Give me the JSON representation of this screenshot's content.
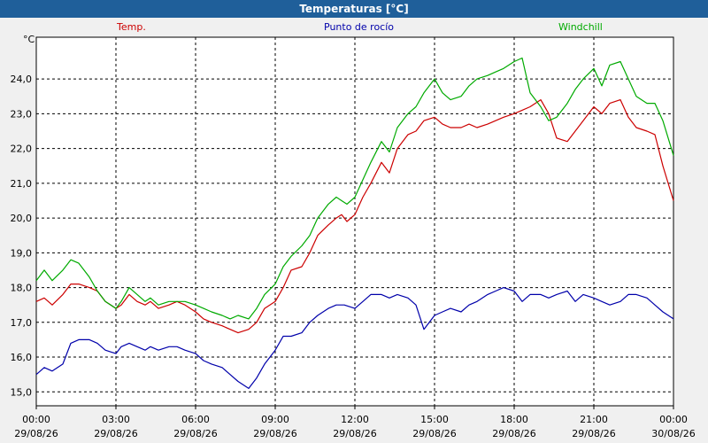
{
  "window": {
    "title": "Temperaturas [°C]"
  },
  "chart_data": {
    "type": "line",
    "title": "Temperaturas [°C]",
    "ylabel": "°C",
    "ylim": [
      14.6,
      25.2
    ],
    "y_ticks": [
      "15,0",
      "16,0",
      "17,0",
      "18,0",
      "19,0",
      "20,0",
      "21,0",
      "22,0",
      "23,0",
      "24,0"
    ],
    "y_tick_values": [
      15,
      16,
      17,
      18,
      19,
      20,
      21,
      22,
      23,
      24
    ],
    "x_ticks": [
      {
        "time": "00:00",
        "date": "29/08/26"
      },
      {
        "time": "03:00",
        "date": "29/08/26"
      },
      {
        "time": "06:00",
        "date": "29/08/26"
      },
      {
        "time": "09:00",
        "date": "29/08/26"
      },
      {
        "time": "12:00",
        "date": "29/08/26"
      },
      {
        "time": "15:00",
        "date": "29/08/26"
      },
      {
        "time": "18:00",
        "date": "29/08/26"
      },
      {
        "time": "21:00",
        "date": "29/08/26"
      },
      {
        "time": "00:00",
        "date": "30/08/26"
      }
    ],
    "x_range_hours": [
      0,
      24
    ],
    "grid": true,
    "series": [
      {
        "name": "Temp.",
        "color": "#cc0000",
        "legend_position": "top-left",
        "points": [
          [
            0,
            17.6
          ],
          [
            0.3,
            17.7
          ],
          [
            0.6,
            17.5
          ],
          [
            1,
            17.8
          ],
          [
            1.3,
            18.1
          ],
          [
            1.6,
            18.1
          ],
          [
            2,
            18.0
          ],
          [
            2.3,
            17.9
          ],
          [
            2.6,
            17.6
          ],
          [
            3,
            17.4
          ],
          [
            3.2,
            17.5
          ],
          [
            3.5,
            17.8
          ],
          [
            3.8,
            17.6
          ],
          [
            4.1,
            17.5
          ],
          [
            4.3,
            17.6
          ],
          [
            4.6,
            17.4
          ],
          [
            5,
            17.5
          ],
          [
            5.3,
            17.6
          ],
          [
            5.6,
            17.5
          ],
          [
            6,
            17.3
          ],
          [
            6.3,
            17.1
          ],
          [
            6.6,
            17.0
          ],
          [
            7,
            16.9
          ],
          [
            7.3,
            16.8
          ],
          [
            7.6,
            16.7
          ],
          [
            8,
            16.8
          ],
          [
            8.3,
            17.0
          ],
          [
            8.6,
            17.4
          ],
          [
            9,
            17.6
          ],
          [
            9.3,
            18.0
          ],
          [
            9.6,
            18.5
          ],
          [
            10,
            18.6
          ],
          [
            10.3,
            19.0
          ],
          [
            10.6,
            19.5
          ],
          [
            11,
            19.8
          ],
          [
            11.3,
            20.0
          ],
          [
            11.5,
            20.1
          ],
          [
            11.7,
            19.9
          ],
          [
            12,
            20.1
          ],
          [
            12.3,
            20.6
          ],
          [
            12.6,
            21.0
          ],
          [
            13,
            21.6
          ],
          [
            13.3,
            21.3
          ],
          [
            13.6,
            22.0
          ],
          [
            14,
            22.4
          ],
          [
            14.3,
            22.5
          ],
          [
            14.6,
            22.8
          ],
          [
            15,
            22.9
          ],
          [
            15.3,
            22.7
          ],
          [
            15.6,
            22.6
          ],
          [
            16,
            22.6
          ],
          [
            16.3,
            22.7
          ],
          [
            16.6,
            22.6
          ],
          [
            17,
            22.7
          ],
          [
            17.3,
            22.8
          ],
          [
            17.6,
            22.9
          ],
          [
            18,
            23.0
          ],
          [
            18.3,
            23.1
          ],
          [
            18.6,
            23.2
          ],
          [
            19,
            23.4
          ],
          [
            19.3,
            23.0
          ],
          [
            19.6,
            22.3
          ],
          [
            20,
            22.2
          ],
          [
            20.3,
            22.5
          ],
          [
            20.6,
            22.8
          ],
          [
            21,
            23.2
          ],
          [
            21.3,
            23.0
          ],
          [
            21.6,
            23.3
          ],
          [
            22,
            23.4
          ],
          [
            22.3,
            22.9
          ],
          [
            22.6,
            22.6
          ],
          [
            23,
            22.5
          ],
          [
            23.3,
            22.4
          ],
          [
            23.6,
            21.5
          ],
          [
            24,
            20.5
          ]
        ]
      },
      {
        "name": "Punto de rocío",
        "color": "#0000aa",
        "legend_position": "top-center",
        "points": [
          [
            0,
            15.5
          ],
          [
            0.3,
            15.7
          ],
          [
            0.6,
            15.6
          ],
          [
            1,
            15.8
          ],
          [
            1.3,
            16.4
          ],
          [
            1.6,
            16.5
          ],
          [
            2,
            16.5
          ],
          [
            2.3,
            16.4
          ],
          [
            2.6,
            16.2
          ],
          [
            3,
            16.1
          ],
          [
            3.2,
            16.3
          ],
          [
            3.5,
            16.4
          ],
          [
            3.8,
            16.3
          ],
          [
            4.1,
            16.2
          ],
          [
            4.3,
            16.3
          ],
          [
            4.6,
            16.2
          ],
          [
            5,
            16.3
          ],
          [
            5.3,
            16.3
          ],
          [
            5.6,
            16.2
          ],
          [
            6,
            16.1
          ],
          [
            6.3,
            15.9
          ],
          [
            6.6,
            15.8
          ],
          [
            7,
            15.7
          ],
          [
            7.3,
            15.5
          ],
          [
            7.6,
            15.3
          ],
          [
            8,
            15.1
          ],
          [
            8.3,
            15.4
          ],
          [
            8.6,
            15.8
          ],
          [
            9,
            16.2
          ],
          [
            9.3,
            16.6
          ],
          [
            9.6,
            16.6
          ],
          [
            10,
            16.7
          ],
          [
            10.3,
            17.0
          ],
          [
            10.6,
            17.2
          ],
          [
            11,
            17.4
          ],
          [
            11.3,
            17.5
          ],
          [
            11.6,
            17.5
          ],
          [
            12,
            17.4
          ],
          [
            12.3,
            17.6
          ],
          [
            12.6,
            17.8
          ],
          [
            13,
            17.8
          ],
          [
            13.3,
            17.7
          ],
          [
            13.6,
            17.8
          ],
          [
            14,
            17.7
          ],
          [
            14.3,
            17.5
          ],
          [
            14.6,
            16.8
          ],
          [
            15,
            17.2
          ],
          [
            15.3,
            17.3
          ],
          [
            15.6,
            17.4
          ],
          [
            16,
            17.3
          ],
          [
            16.3,
            17.5
          ],
          [
            16.6,
            17.6
          ],
          [
            17,
            17.8
          ],
          [
            17.3,
            17.9
          ],
          [
            17.6,
            18.0
          ],
          [
            18,
            17.9
          ],
          [
            18.3,
            17.6
          ],
          [
            18.6,
            17.8
          ],
          [
            19,
            17.8
          ],
          [
            19.3,
            17.7
          ],
          [
            19.6,
            17.8
          ],
          [
            20,
            17.9
          ],
          [
            20.3,
            17.6
          ],
          [
            20.6,
            17.8
          ],
          [
            21,
            17.7
          ],
          [
            21.3,
            17.6
          ],
          [
            21.6,
            17.5
          ],
          [
            22,
            17.6
          ],
          [
            22.3,
            17.8
          ],
          [
            22.6,
            17.8
          ],
          [
            23,
            17.7
          ],
          [
            23.3,
            17.5
          ],
          [
            23.6,
            17.3
          ],
          [
            24,
            17.1
          ]
        ]
      },
      {
        "name": "Windchill",
        "color": "#00aa00",
        "legend_position": "top-right",
        "points": [
          [
            0,
            18.2
          ],
          [
            0.3,
            18.5
          ],
          [
            0.6,
            18.2
          ],
          [
            1,
            18.5
          ],
          [
            1.3,
            18.8
          ],
          [
            1.6,
            18.7
          ],
          [
            2,
            18.3
          ],
          [
            2.3,
            17.9
          ],
          [
            2.6,
            17.6
          ],
          [
            3,
            17.4
          ],
          [
            3.2,
            17.6
          ],
          [
            3.5,
            18.0
          ],
          [
            3.8,
            17.8
          ],
          [
            4.1,
            17.6
          ],
          [
            4.3,
            17.7
          ],
          [
            4.6,
            17.5
          ],
          [
            5,
            17.6
          ],
          [
            5.3,
            17.6
          ],
          [
            5.6,
            17.6
          ],
          [
            6,
            17.5
          ],
          [
            6.3,
            17.4
          ],
          [
            6.6,
            17.3
          ],
          [
            7,
            17.2
          ],
          [
            7.3,
            17.1
          ],
          [
            7.6,
            17.2
          ],
          [
            8,
            17.1
          ],
          [
            8.3,
            17.4
          ],
          [
            8.6,
            17.8
          ],
          [
            9,
            18.1
          ],
          [
            9.3,
            18.6
          ],
          [
            9.6,
            18.9
          ],
          [
            10,
            19.2
          ],
          [
            10.3,
            19.5
          ],
          [
            10.6,
            20.0
          ],
          [
            11,
            20.4
          ],
          [
            11.3,
            20.6
          ],
          [
            11.5,
            20.5
          ],
          [
            11.7,
            20.4
          ],
          [
            12,
            20.6
          ],
          [
            12.3,
            21.1
          ],
          [
            12.6,
            21.6
          ],
          [
            13,
            22.2
          ],
          [
            13.3,
            21.9
          ],
          [
            13.6,
            22.6
          ],
          [
            14,
            23.0
          ],
          [
            14.3,
            23.2
          ],
          [
            14.6,
            23.6
          ],
          [
            15,
            24.0
          ],
          [
            15.3,
            23.6
          ],
          [
            15.6,
            23.4
          ],
          [
            16,
            23.5
          ],
          [
            16.3,
            23.8
          ],
          [
            16.6,
            24.0
          ],
          [
            17,
            24.1
          ],
          [
            17.3,
            24.2
          ],
          [
            17.6,
            24.3
          ],
          [
            18,
            24.5
          ],
          [
            18.3,
            24.6
          ],
          [
            18.6,
            23.6
          ],
          [
            19,
            23.2
          ],
          [
            19.3,
            22.8
          ],
          [
            19.6,
            22.9
          ],
          [
            20,
            23.3
          ],
          [
            20.3,
            23.7
          ],
          [
            20.6,
            24.0
          ],
          [
            21,
            24.3
          ],
          [
            21.3,
            23.8
          ],
          [
            21.6,
            24.4
          ],
          [
            22,
            24.5
          ],
          [
            22.3,
            24.0
          ],
          [
            22.6,
            23.5
          ],
          [
            23,
            23.3
          ],
          [
            23.3,
            23.3
          ],
          [
            23.6,
            22.8
          ],
          [
            24,
            21.8
          ]
        ]
      }
    ]
  }
}
